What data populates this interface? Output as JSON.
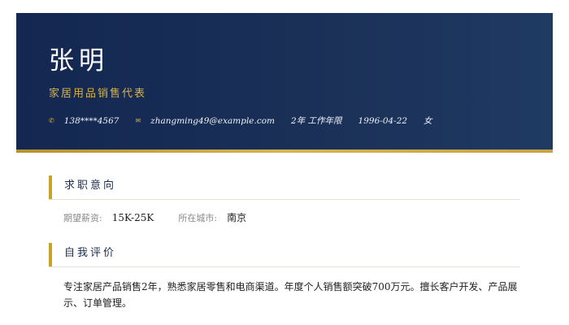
{
  "header": {
    "name": "张明",
    "title": "家居用品销售代表",
    "contacts": {
      "phone": "138****4567",
      "email": "zhangming49@example.com",
      "experience": "2年 工作年限",
      "birthdate": "1996-04-22",
      "gender": "女"
    },
    "icons": {
      "phone": "phone-icon",
      "email": "email-icon"
    }
  },
  "sections": {
    "intent": {
      "title": "求职意向",
      "salary_label": "期望薪资:",
      "salary_value": "15K-25K",
      "city_label": "所在城市:",
      "city_value": "南京"
    },
    "summary": {
      "title": "自我评价",
      "text": "专注家居产品销售2年，熟悉家居零售和电商渠道。年度个人销售额突破700万元。擅长客户开发、产品展示、订单管理。"
    }
  },
  "colors": {
    "header_bg": "#1b3158",
    "accent_gold": "#c9a227",
    "heading_navy": "#1a2e52"
  }
}
